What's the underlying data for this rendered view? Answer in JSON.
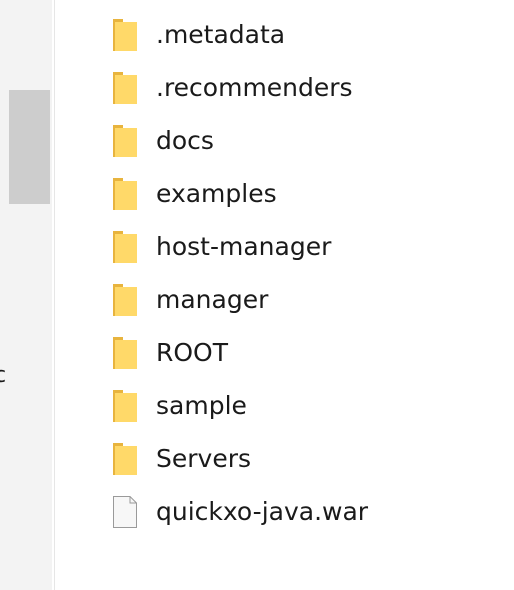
{
  "navigation": {
    "clipped_text": "c"
  },
  "files": [
    {
      "name": ".metadata",
      "type": "folder-icon"
    },
    {
      "name": ".recommenders",
      "type": "folder-icon"
    },
    {
      "name": "docs",
      "type": "folder-icon"
    },
    {
      "name": "examples",
      "type": "folder-icon"
    },
    {
      "name": "host-manager",
      "type": "folder-icon"
    },
    {
      "name": "manager",
      "type": "folder-icon"
    },
    {
      "name": "ROOT",
      "type": "folder-icon"
    },
    {
      "name": "sample",
      "type": "folder-icon"
    },
    {
      "name": "Servers",
      "type": "folder-icon"
    },
    {
      "name": "quickxo-java.war",
      "type": "file-icon"
    }
  ],
  "colors": {
    "folder_front": "#ffd969",
    "folder_back": "#f2c24c",
    "text": "#1a1a1a",
    "nav_background": "#f3f3f3",
    "scroll_thumb": "#cdcdcd"
  }
}
